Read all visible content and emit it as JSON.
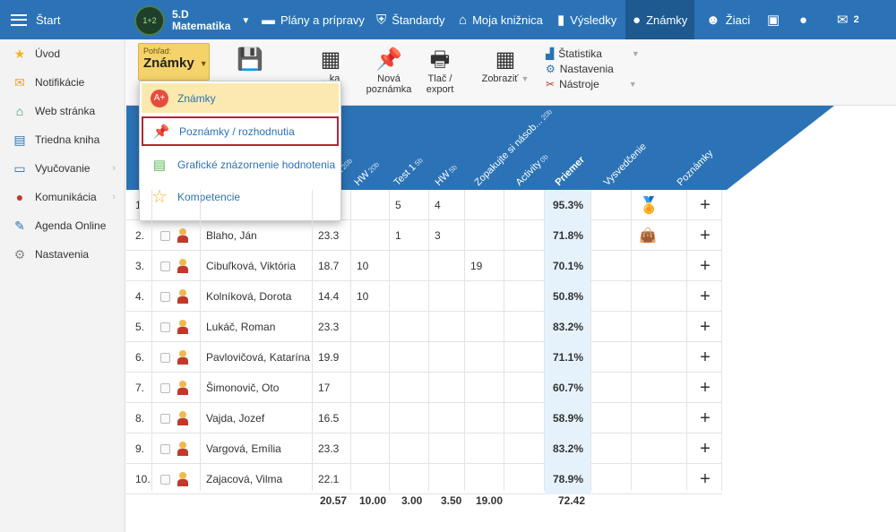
{
  "topbar": {
    "start_label": "Štart",
    "class_name": "5.D",
    "subject": "Matematika",
    "nav": [
      {
        "label": "Plány a prípravy",
        "icon": "book-icon"
      },
      {
        "label": "Štandardy",
        "icon": "shield-icon"
      },
      {
        "label": "Moja knižnica",
        "icon": "library-icon"
      },
      {
        "label": "Výsledky",
        "icon": "bar-chart-icon"
      },
      {
        "label": "Známky",
        "icon": "grade-icon",
        "active": true
      },
      {
        "label": "Žiaci",
        "icon": "students-icon"
      }
    ],
    "message_count": "2"
  },
  "sidebar": {
    "items": [
      {
        "label": "Úvod",
        "icon": "star-icon"
      },
      {
        "label": "Notifikácie",
        "icon": "envelope-icon"
      },
      {
        "label": "Web stránka",
        "icon": "home-icon"
      },
      {
        "label": "Triedna kniha",
        "icon": "notebook-icon"
      },
      {
        "label": "Vyučovanie",
        "icon": "book-icon",
        "arrow": "›"
      },
      {
        "label": "Komunikácia",
        "icon": "chat-icon",
        "arrow": "›"
      },
      {
        "label": "Agenda Online",
        "icon": "pen-icon"
      },
      {
        "label": "Nastavenia",
        "icon": "gear-icon"
      }
    ]
  },
  "toolbar": {
    "view_label": "Pohľad:",
    "view_value": "Známky",
    "partial_a": "...ka",
    "partial_b": "...e",
    "new_note": "Nová poznámka",
    "print_export": "Tlač / export",
    "show": "Zobraziť",
    "stats": "Štatistika",
    "settings": "Nastavenia",
    "tools": "Nástroje"
  },
  "dropdown": {
    "items": [
      {
        "label": "Známky",
        "icon": "grade-icon"
      },
      {
        "label": "Poznámky / rozhodnutia",
        "icon": "pin-icon"
      },
      {
        "label": "Grafické znázornenie hodnotenia",
        "icon": "chart-icon"
      },
      {
        "label": "Kompetencie",
        "icon": "star-icon"
      }
    ]
  },
  "columns": [
    {
      "label": "...est",
      "sub": "20b"
    },
    {
      "label": "HW",
      "sub": "20b"
    },
    {
      "label": "Test 1",
      "sub": "5b"
    },
    {
      "label": "HW",
      "sub": "5b"
    },
    {
      "label": "Zopakujte si násob...",
      "sub": "20b"
    },
    {
      "label": "Activity",
      "sub": "0b"
    },
    {
      "label": "Priemer",
      "sub": ""
    },
    {
      "label": "Vysvedčenie",
      "sub": ""
    },
    {
      "label": "Poznámky",
      "sub": ""
    }
  ],
  "students": [
    {
      "num": "1.",
      "name": "",
      "g": [
        "",
        "",
        "5",
        "4",
        "",
        ""
      ],
      "avg": "95.3%",
      "cert": "medal"
    },
    {
      "num": "2.",
      "name": "Blaho, Ján",
      "g": [
        "23.3",
        "",
        "1",
        "3",
        "",
        ""
      ],
      "avg": "71.8%",
      "cert": "bag"
    },
    {
      "num": "3.",
      "name": "Cibuľková, Viktória",
      "g": [
        "18.7",
        "10",
        "",
        "",
        "19",
        ""
      ],
      "avg": "70.1%",
      "cert": ""
    },
    {
      "num": "4.",
      "name": "Kolníková, Dorota",
      "g": [
        "14.4",
        "10",
        "",
        "",
        "",
        ""
      ],
      "avg": "50.8%",
      "cert": ""
    },
    {
      "num": "5.",
      "name": "Lukáč, Roman",
      "g": [
        "23.3",
        "",
        "",
        "",
        "",
        ""
      ],
      "avg": "83.2%",
      "cert": ""
    },
    {
      "num": "6.",
      "name": "Pavlovičová, Katarína",
      "g": [
        "19.9",
        "",
        "",
        "",
        "",
        ""
      ],
      "avg": "71.1%",
      "cert": ""
    },
    {
      "num": "7.",
      "name": "Šimonovič, Oto",
      "g": [
        "17",
        "",
        "",
        "",
        "",
        ""
      ],
      "avg": "60.7%",
      "cert": ""
    },
    {
      "num": "8.",
      "name": "Vajda, Jozef",
      "g": [
        "16.5",
        "",
        "",
        "",
        "",
        ""
      ],
      "avg": "58.9%",
      "cert": ""
    },
    {
      "num": "9.",
      "name": "Vargová, Emília",
      "g": [
        "23.3",
        "",
        "",
        "",
        "",
        ""
      ],
      "avg": "83.2%",
      "cert": ""
    },
    {
      "num": "10.",
      "name": "Zajacová, Vilma",
      "g": [
        "22.1",
        "",
        "",
        "",
        "",
        ""
      ],
      "avg": "78.9%",
      "cert": ""
    }
  ],
  "footer": {
    "c1": "20.57",
    "c2": "10.00",
    "c3": "3.00",
    "c4": "3.50",
    "c5": "19.00",
    "avg": "72.42"
  },
  "plus_glyph": "+"
}
